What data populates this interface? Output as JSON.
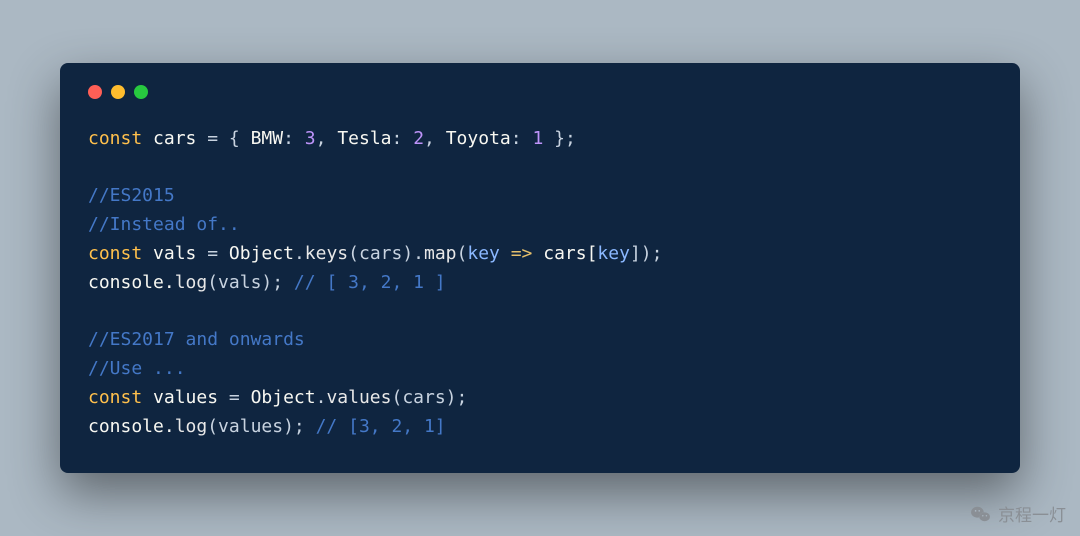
{
  "traffic": {
    "red": "#ff5f56",
    "yellow": "#ffbd2e",
    "green": "#27c93f"
  },
  "code": {
    "l1_const": "const",
    "l1_var": "cars",
    "l1_eq": " = { ",
    "l1_k1": "BMW",
    "l1_c1": ": ",
    "l1_v1": "3",
    "l1_s1": ", ",
    "l1_k2": "Tesla",
    "l1_c2": ": ",
    "l1_v2": "2",
    "l1_s2": ", ",
    "l1_k3": "Toyota",
    "l1_c3": ": ",
    "l1_v3": "1",
    "l1_end": " };",
    "l3": "//ES2015",
    "l4": "//Instead of..",
    "l5_const": "const",
    "l5_var": "vals",
    "l5_eq": " = ",
    "l5_obj": "Object",
    "l5_d1": ".",
    "l5_keys": "keys",
    "l5_p1": "(cars).",
    "l5_map": "map",
    "l5_p2": "(",
    "l5_key": "key",
    "l5_arrow": " => ",
    "l5_body": "cars[",
    "l5_key2": "key",
    "l5_end": "]);",
    "l6_a": "console.",
    "l6_log": "log",
    "l6_b": "(vals); ",
    "l6_cmt": "// [ 3, 2, 1 ]",
    "l8": "//ES2017 and onwards",
    "l9": "//Use ...",
    "l10_const": "const",
    "l10_var": "values",
    "l10_eq": " = ",
    "l10_obj": "Object",
    "l10_d": ".",
    "l10_vals": "values",
    "l10_end": "(cars);",
    "l11_a": "console.",
    "l11_log": "log",
    "l11_b": "(values); ",
    "l11_cmt": "// [3, 2, 1]"
  },
  "watermark": "京程一灯"
}
